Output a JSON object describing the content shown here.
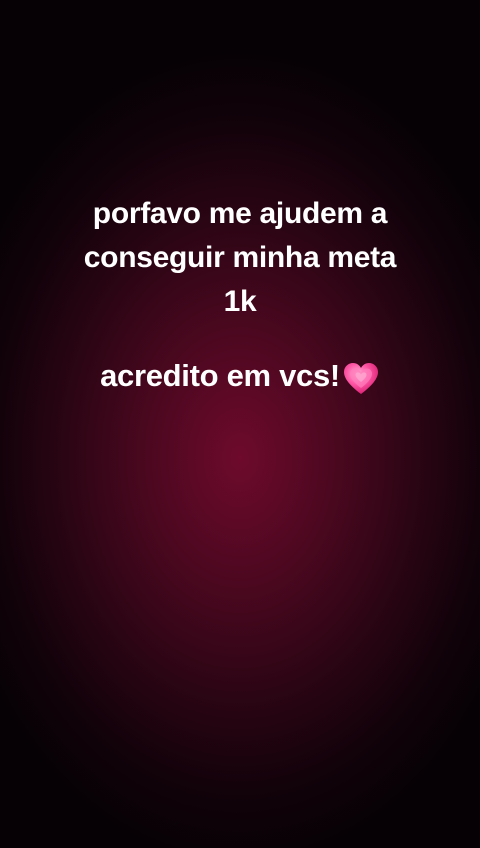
{
  "message": {
    "line1": "porfavo me ajudem a",
    "line2": "conseguir minha meta",
    "line3": "1k"
  },
  "closing": {
    "text": "acredito em vcs!",
    "icon": "growing-heart-emoji"
  },
  "colors": {
    "background_center": "#6e0a2c",
    "background_edge": "#060105",
    "text": "#ffffff",
    "heart": "#ff4fa0"
  }
}
